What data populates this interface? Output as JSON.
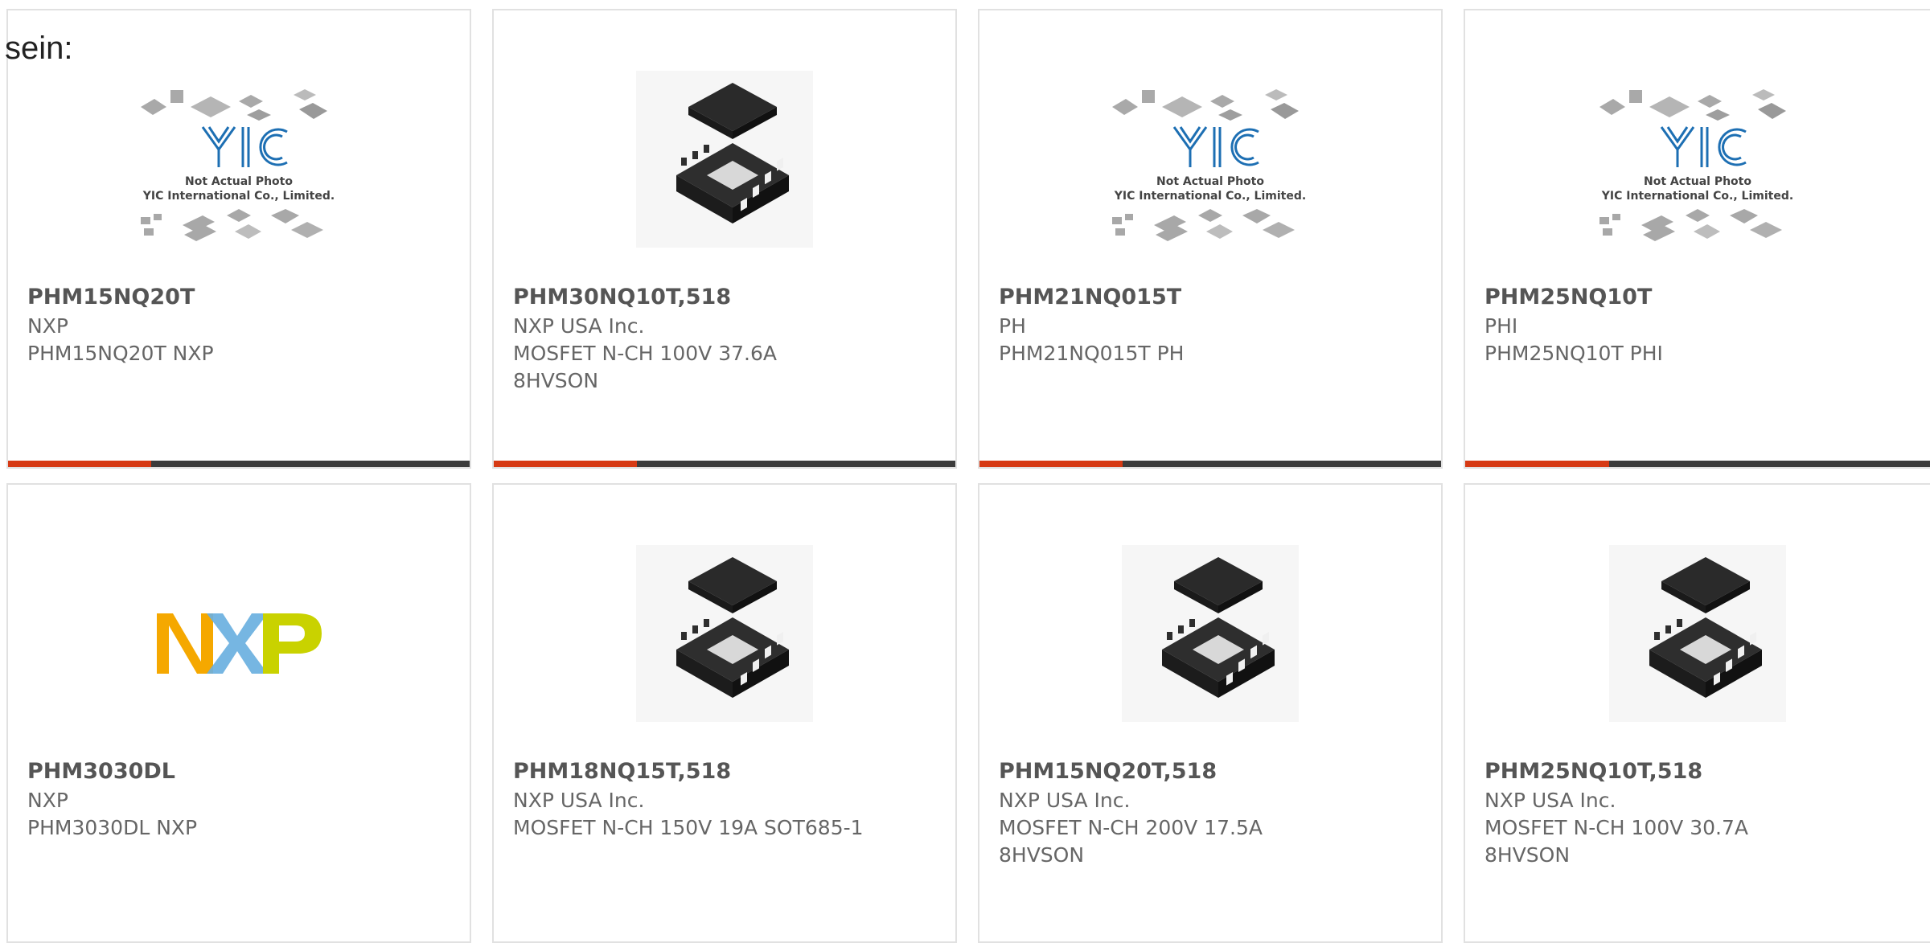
{
  "intro_text": "sein:",
  "accent_colors": {
    "primary": "#d63a14",
    "track": "#3c3c3c"
  },
  "placeholder": {
    "line1": "Not Actual Photo",
    "line2": "YIC International Co., Limited.",
    "logo_text": "YIC"
  },
  "nxp_logo": {
    "letters": [
      "N",
      "X",
      "P"
    ],
    "colors": [
      "#f5a800",
      "#6ab0e0",
      "#c9d200"
    ]
  },
  "products": [
    {
      "part": "PHM15NQ20T",
      "maker": "NXP",
      "desc": "PHM15NQ20T NXP",
      "image": "placeholder-photo",
      "accent_fraction": 0.31
    },
    {
      "part": "PHM30NQ10T,518",
      "maker": "NXP USA Inc.",
      "desc": "MOSFET N-CH 100V 37.6A 8HVSON",
      "image": "ic-chip-hvson",
      "accent_fraction": 0.31
    },
    {
      "part": "PHM21NQ015T",
      "maker": "PH",
      "desc": "PHM21NQ015T PH",
      "image": "placeholder-photo",
      "accent_fraction": 0.31
    },
    {
      "part": "PHM25NQ10T",
      "maker": "PHI",
      "desc": "PHM25NQ10T PHI",
      "image": "placeholder-photo",
      "accent_fraction": 0.31
    },
    {
      "part": "PHM3030DL",
      "maker": "NXP",
      "desc": "PHM3030DL NXP",
      "image": "nxp-logo",
      "accent_fraction": 0
    },
    {
      "part": "PHM18NQ15T,518",
      "maker": "NXP USA Inc.",
      "desc": "MOSFET N-CH 150V 19A SOT685-1",
      "image": "ic-chip-hvson",
      "accent_fraction": 0
    },
    {
      "part": "PHM15NQ20T,518",
      "maker": "NXP USA Inc.",
      "desc": "MOSFET N-CH 200V 17.5A 8HVSON",
      "image": "ic-chip-hvson",
      "accent_fraction": 0
    },
    {
      "part": "PHM25NQ10T,518",
      "maker": "NXP USA Inc.",
      "desc": "MOSFET N-CH 100V 30.7A 8HVSON",
      "image": "ic-chip-hvson",
      "accent_fraction": 0
    }
  ]
}
